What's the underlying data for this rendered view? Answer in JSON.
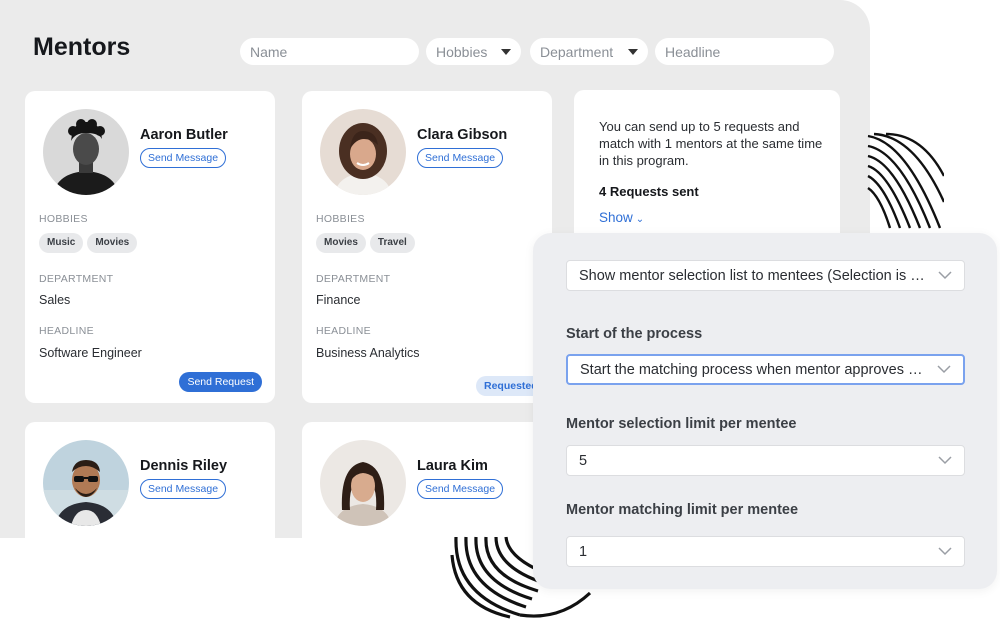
{
  "header": {
    "title": "Mentors",
    "filters": {
      "name_placeholder": "Name",
      "hobbies_label": "Hobbies",
      "department_label": "Department",
      "headline_placeholder": "Headline"
    }
  },
  "labels": {
    "hobbies": "HOBBIES",
    "department": "DEPARTMENT",
    "headline": "HEADLINE",
    "send_message": "Send Message",
    "send_request": "Send Request",
    "requested": "Requested"
  },
  "mentors": [
    {
      "name": "Aaron Butler",
      "hobbies": [
        "Music",
        "Movies"
      ],
      "department": "Sales",
      "headline": "Software Engineer",
      "action": "Send Request"
    },
    {
      "name": "Clara Gibson",
      "hobbies": [
        "Movies",
        "Travel"
      ],
      "department": "Finance",
      "headline": "Business Analytics",
      "action": "Requested"
    },
    {
      "name": "Dennis Riley"
    },
    {
      "name": "Laura Kim"
    }
  ],
  "info": {
    "text": "You can send up to 5 requests and match with 1 mentors at the same time in this program.",
    "requests_sent": "4 Requests sent",
    "show_label": "Show"
  },
  "settings": {
    "visibility_value": "Show mentor selection list to mentees (Selection is on)",
    "start_label": "Start of the process",
    "start_value": "Start the matching process when mentor approves m...",
    "selection_limit_label": "Mentor selection limit per mentee",
    "selection_limit_value": "5",
    "matching_limit_label": "Mentor matching limit per mentee",
    "matching_limit_value": "1"
  },
  "colors": {
    "accent": "#2f6fd6",
    "panel_bg": "#ebebeb",
    "settings_bg": "#edeef1"
  }
}
